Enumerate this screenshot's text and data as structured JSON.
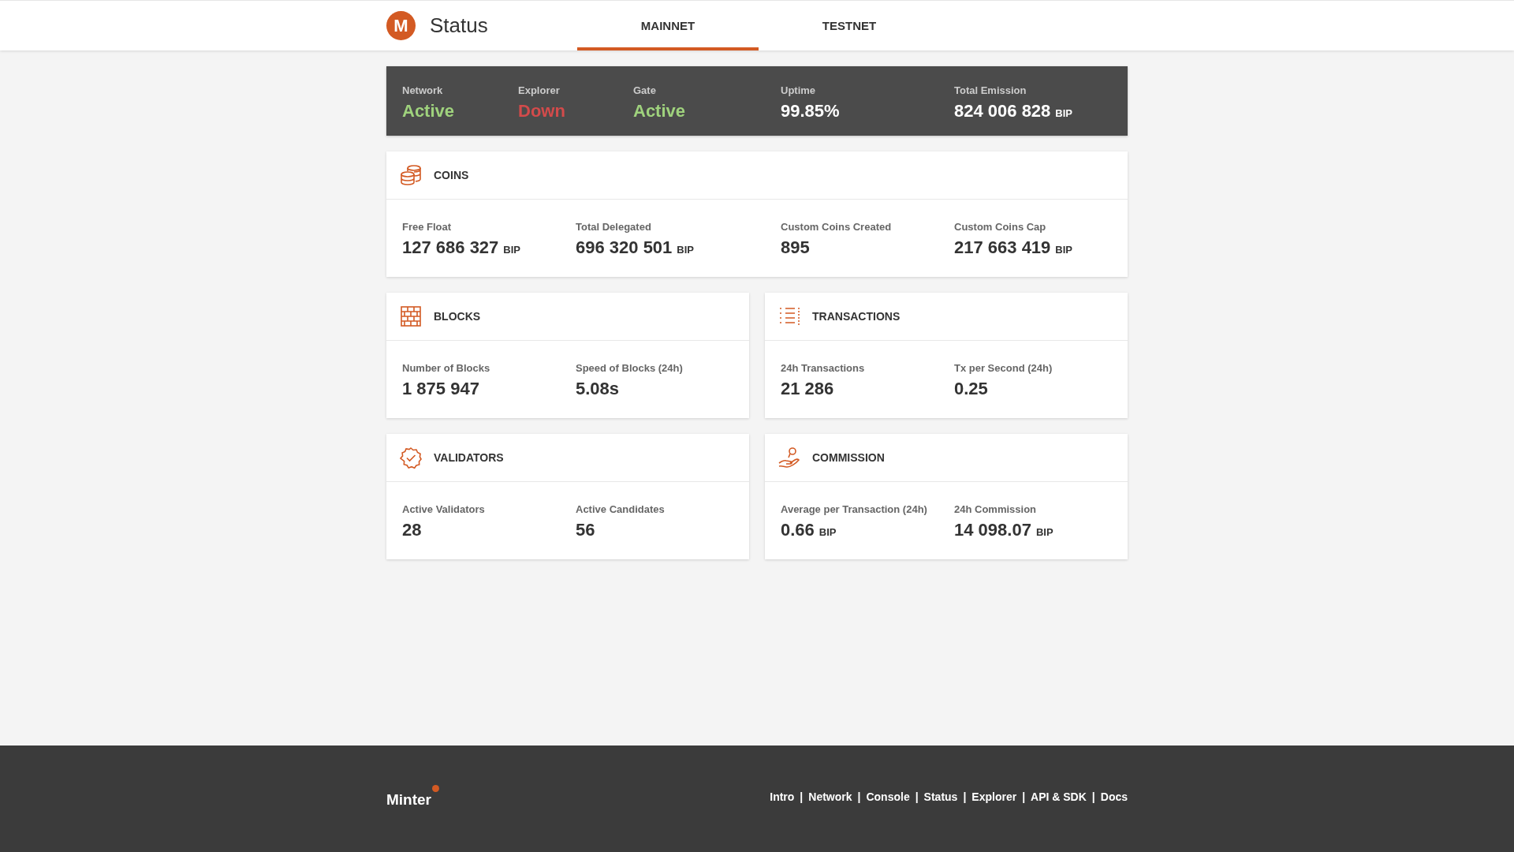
{
  "header": {
    "logo_letter": "M",
    "title": "Status",
    "tabs": [
      {
        "label": "MAINNET",
        "selected": true
      },
      {
        "label": "TESTNET",
        "selected": false
      }
    ]
  },
  "summary": [
    {
      "label": "Network",
      "value": "Active",
      "color": "#9fd27d"
    },
    {
      "label": "Explorer",
      "value": "Down",
      "color": "#d34b4b"
    },
    {
      "label": "Gate",
      "value": "Active",
      "color": "#9fd27d"
    },
    {
      "label": "Uptime",
      "value": "99.85%"
    },
    {
      "label": "Total Emission",
      "value": "824 006 828",
      "unit": "BIP"
    }
  ],
  "cards": [
    {
      "title": "COINS",
      "stats": [
        {
          "label": "Free Float",
          "value": "127 686 327",
          "unit": "BIP"
        },
        {
          "label": "Total Delegated",
          "value": "696 320 501",
          "unit": "BIP"
        },
        {
          "label": "Custom Coins Created",
          "value": "895"
        },
        {
          "label": "Custom Coins Cap",
          "value": "217 663 419",
          "unit": "BIP"
        }
      ]
    },
    {
      "title": "BLOCKS",
      "stats": [
        {
          "label": "Number of Blocks",
          "value": "1 875 947"
        },
        {
          "label": "Speed of Blocks (24h)",
          "value": "5.08s"
        }
      ]
    },
    {
      "title": "TRANSACTIONS",
      "stats": [
        {
          "label": "24h Transactions",
          "value": "21 286"
        },
        {
          "label": "Tx per Second (24h)",
          "value": "0.25"
        }
      ]
    },
    {
      "title": "VALIDATORS",
      "stats": [
        {
          "label": "Active Validators",
          "value": "28"
        },
        {
          "label": "Active Candidates",
          "value": "56"
        }
      ]
    },
    {
      "title": "COMMISSION",
      "stats": [
        {
          "label": "Average per Transaction (24h)",
          "value": "0.66",
          "unit": "BIP"
        },
        {
          "label": "24h Commission",
          "value": "14 098.07",
          "unit": "BIP"
        }
      ]
    }
  ],
  "footer": {
    "brand": "Minter",
    "separator": "|",
    "links": [
      "Intro",
      "Network",
      "Console",
      "Status",
      "Explorer",
      "API & SDK",
      "Docs"
    ]
  }
}
